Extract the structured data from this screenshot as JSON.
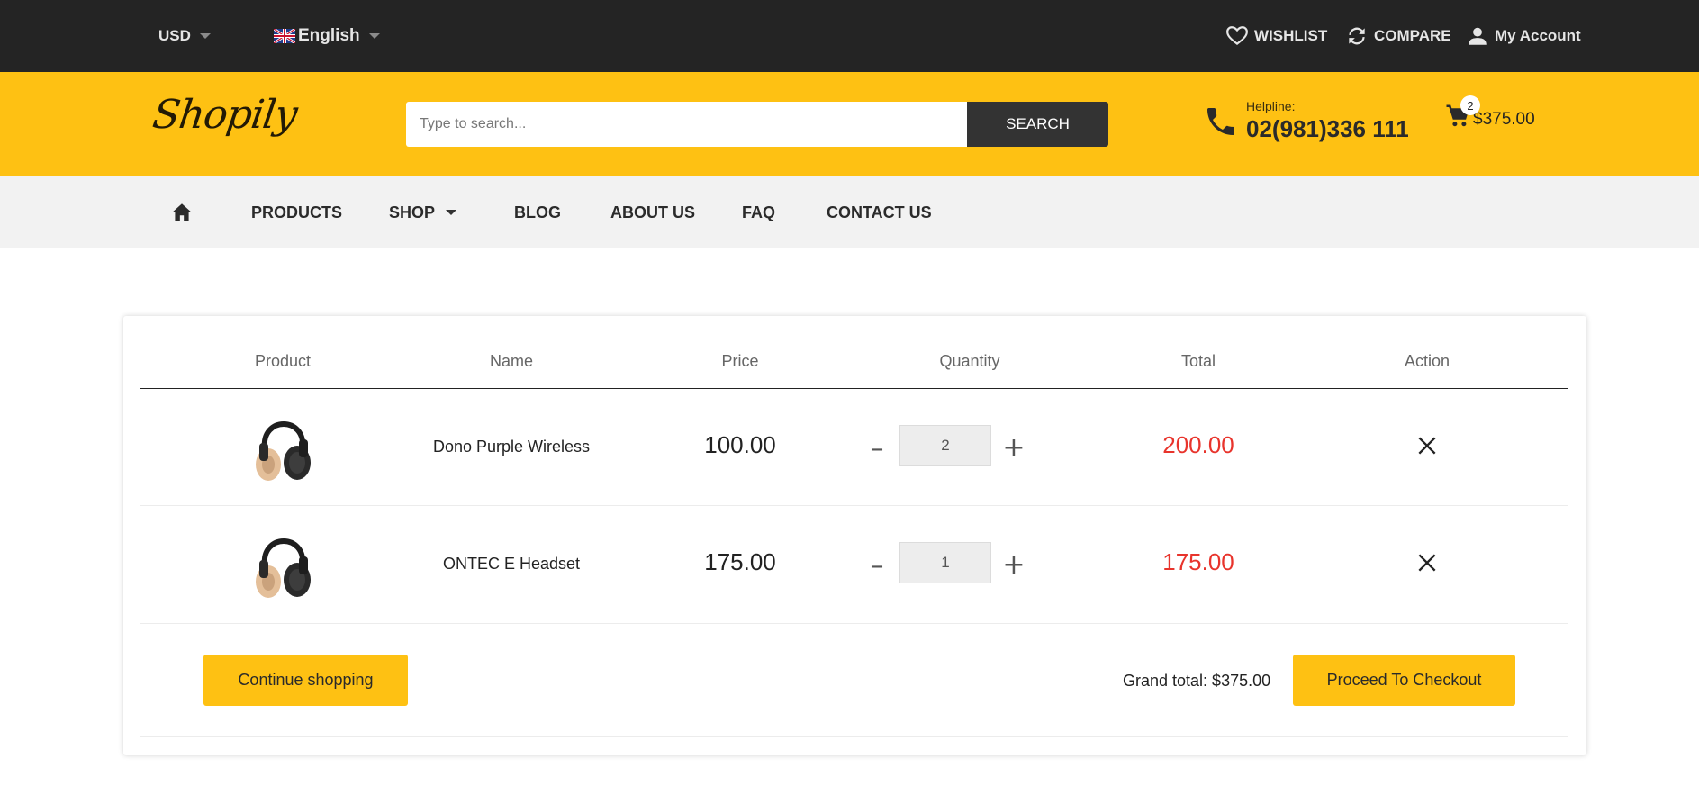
{
  "topbar": {
    "currency": "USD",
    "language": "English",
    "wishlist": "WISHLIST",
    "compare": "COMPARE",
    "account": "My Account"
  },
  "header": {
    "logo": "Shopily",
    "search_placeholder": "Type to search...",
    "search_button": "SEARCH",
    "helpline_label": "Helpline:",
    "helpline_number": "02(981)336 111",
    "cart_count": "2",
    "cart_total": "$375.00"
  },
  "nav": {
    "items": [
      "PRODUCTS",
      "SHOP",
      "BLOG",
      "ABOUT US",
      "FAQ",
      "CONTACT US"
    ]
  },
  "cart": {
    "columns": [
      "Product",
      "Name",
      "Price",
      "Quantity",
      "Total",
      "Action"
    ],
    "rows": [
      {
        "name": "Dono Purple Wireless",
        "price": "100.00",
        "quantity": "2",
        "total": "200.00"
      },
      {
        "name": "ONTEC E Headset",
        "price": "175.00",
        "quantity": "1",
        "total": "175.00"
      }
    ],
    "continue_label": "Continue shopping",
    "grand_total": "Grand total: $375.00",
    "checkout_label": "Proceed To Checkout"
  },
  "colors": {
    "accent": "#fec113",
    "dark": "#242424",
    "total_red": "#e8342c"
  }
}
